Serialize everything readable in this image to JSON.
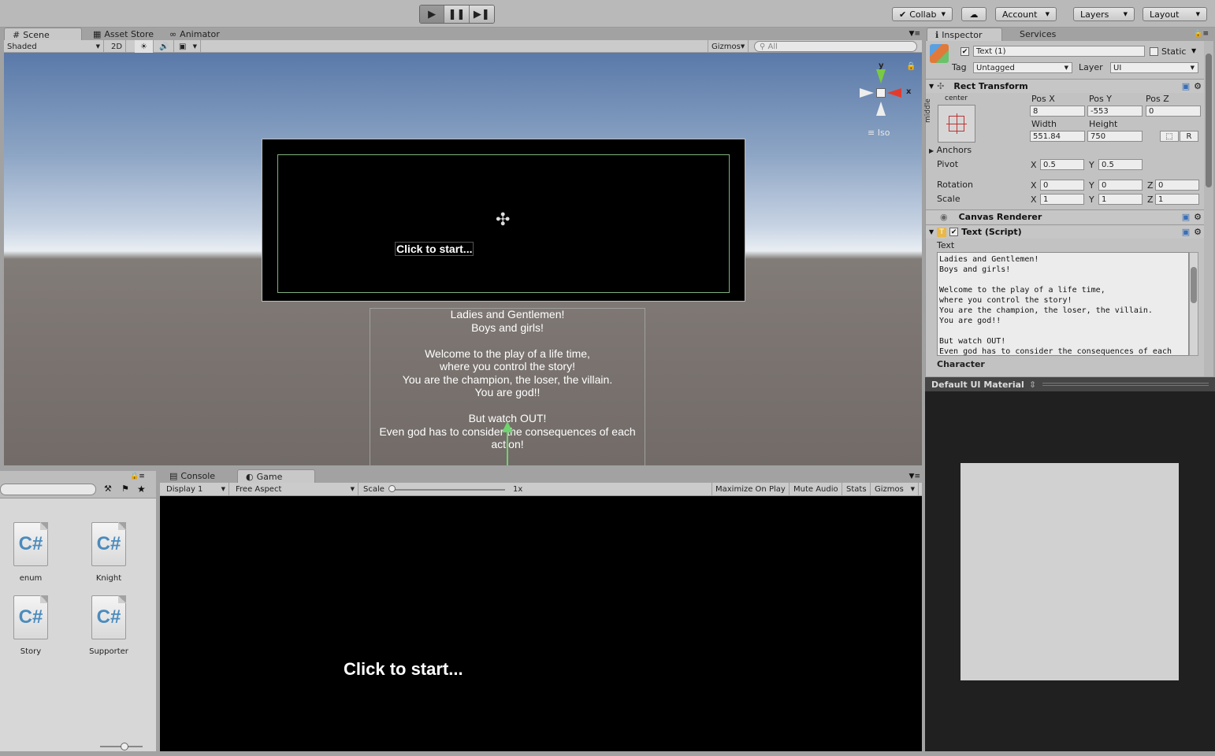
{
  "toolbar": {
    "collab": "Collab",
    "account": "Account",
    "layers": "Layers",
    "layout": "Layout"
  },
  "scene": {
    "tabs": [
      "Scene",
      "Asset Store",
      "Animator"
    ],
    "shading": "Shaded",
    "mode2d": "2D",
    "gizmos": "Gizmos",
    "search_placeholder": "All",
    "axis_y": "y",
    "axis_x": "x",
    "projection": "Iso",
    "canvas_button": "Click to start...",
    "story_text": "Ladies and Gentlemen!\nBoys and girls!\n\nWelcome to the play of a life time,\nwhere you control the story!\nYou are the champion, the loser, the villain.\nYou are god!!\n\nBut watch OUT!\nEven god has to consider the consequences of each\naction!"
  },
  "project": {
    "assets": [
      "enum",
      "Knight",
      "Story",
      "Supporter"
    ],
    "icon_glyph": "C#"
  },
  "game": {
    "tabs": [
      "Console",
      "Game"
    ],
    "display": "Display 1",
    "aspect": "Free Aspect",
    "scale_label": "Scale",
    "scale_value": "1x",
    "maximize": "Maximize On Play",
    "mute": "Mute Audio",
    "stats": "Stats",
    "gizmos": "Gizmos",
    "button_text": "Click to start..."
  },
  "inspector": {
    "tabs": [
      "Inspector",
      "Services"
    ],
    "object_name": "Text (1)",
    "static_label": "Static",
    "tag_label": "Tag",
    "tag_value": "Untagged",
    "layer_label": "Layer",
    "layer_value": "UI",
    "rect_transform": "Rect Transform",
    "anchor_h": "center",
    "anchor_v": "middle",
    "pos_x_label": "Pos X",
    "pos_y_label": "Pos Y",
    "pos_z_label": "Pos Z",
    "pos_x": "8",
    "pos_y": "-553",
    "pos_z": "0",
    "width_label": "Width",
    "height_label": "Height",
    "width": "551.84",
    "height": "750",
    "r_button": "R",
    "anchors": "Anchors",
    "pivot": "Pivot",
    "pivot_x": "0.5",
    "pivot_y": "0.5",
    "rotation": "Rotation",
    "rot_x": "0",
    "rot_y": "0",
    "rot_z": "0",
    "scale": "Scale",
    "scale_x": "1",
    "scale_y": "1",
    "scale_z": "1",
    "x": "X",
    "y": "Y",
    "z": "Z",
    "canvas_renderer": "Canvas Renderer",
    "text_script": "Text (Script)",
    "text_label": "Text",
    "text_value": "Ladies and Gentlemen!\nBoys and girls!\n\nWelcome to the play of a life time,\nwhere you control the story!\nYou are the champion, the loser, the villain.\nYou are god!!\n\nBut watch OUT!\nEven god has to consider the consequences of each",
    "character": "Character"
  },
  "preview": {
    "title": "Default UI Material"
  }
}
